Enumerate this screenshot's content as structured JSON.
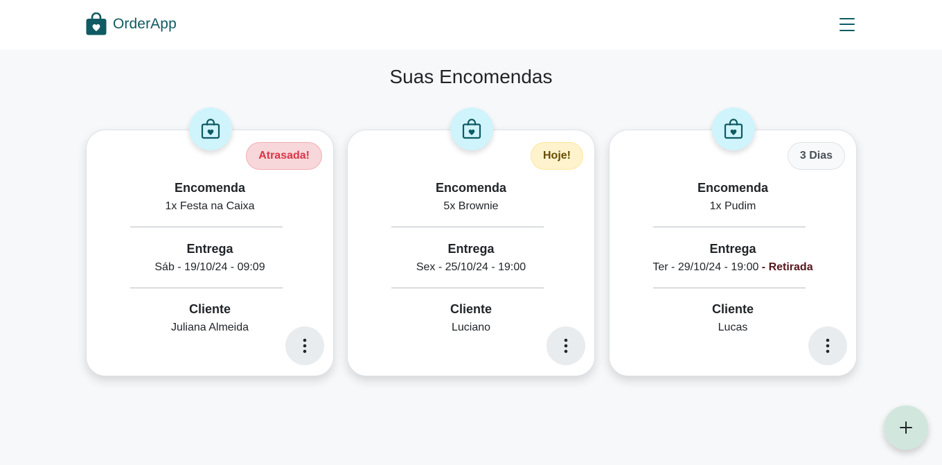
{
  "app": {
    "name": "OrderApp",
    "icons": {
      "logo": "shopping-bag-heart-icon",
      "menu": "hamburger-menu-icon"
    }
  },
  "page": {
    "title": "Suas Encomendas"
  },
  "labels": {
    "order": "Encomenda",
    "delivery": "Entrega",
    "client": "Cliente"
  },
  "orders": [
    {
      "status": "Atrasada!",
      "status_variant": "danger",
      "item": "1x Festa na Caixa",
      "delivery": "Sáb - 19/10/24 - 09:09",
      "pickup_label": "",
      "client": "Juliana Almeida"
    },
    {
      "status": "Hoje!",
      "status_variant": "warning",
      "item": "5x Brownie",
      "delivery": "Sex - 25/10/24 - 19:00",
      "pickup_label": "",
      "client": "Luciano"
    },
    {
      "status": "3 Dias",
      "status_variant": "secondary",
      "item": "1x Pudim",
      "delivery": "Ter - 29/10/24 - 19:00",
      "pickup_label": " - Retirada",
      "client": "Lucas"
    }
  ],
  "colors": {
    "brand": "#0f5a63",
    "icon_circle": "#cff4fc",
    "danger_bg": "#f8d7da",
    "danger_text": "#dc3545",
    "warning_bg": "#fff3cd",
    "warning_text": "#664d03",
    "secondary_bg": "#f8f9fa",
    "pickup_text": "#58151c",
    "fab_bg": "#d1e7dd"
  },
  "actions": {
    "card_menu_icon": "vertical-dots-icon",
    "add_icon": "plus-icon"
  }
}
